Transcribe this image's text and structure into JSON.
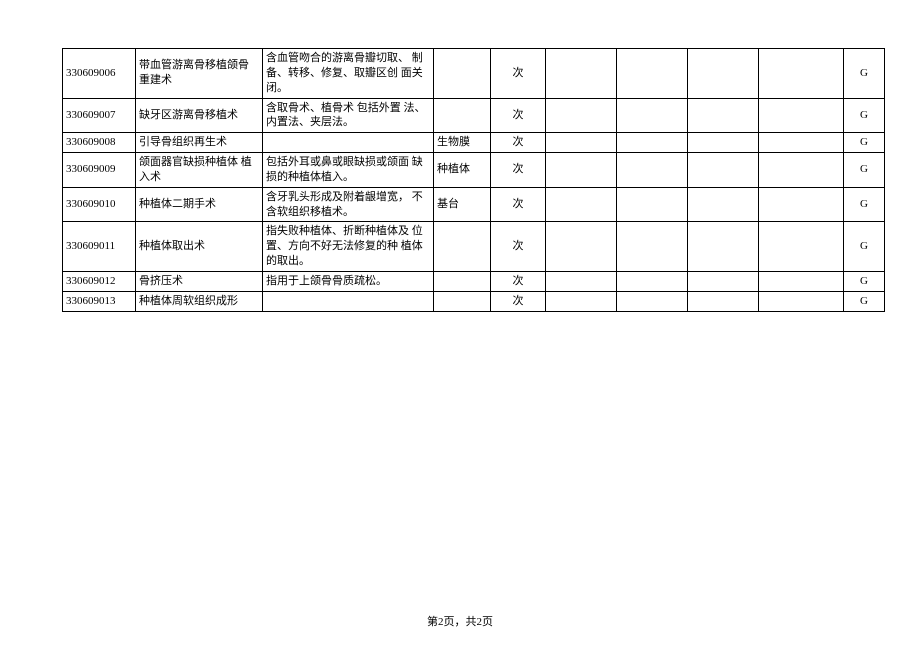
{
  "table": {
    "rows": [
      {
        "code": "330609006",
        "name": "带血管游离骨移植颌骨重建术",
        "desc": "含血管吻合的游离骨瓣切取、 制备、转移、修复、取瓣区创 面关闭。",
        "note": "",
        "unit": "次",
        "a": "",
        "b": "",
        "c": "",
        "d": "",
        "grade": "G"
      },
      {
        "code": "330609007",
        "name": "缺牙区游离骨移植术",
        "desc": "含取骨术、植骨术 包括外置 法、内置法、夹层法。",
        "note": "",
        "unit": "次",
        "a": "",
        "b": "",
        "c": "",
        "d": "",
        "grade": "G"
      },
      {
        "code": "330609008",
        "name": "引导骨组织再生术",
        "desc": "",
        "note": "生物膜",
        "unit": "次",
        "a": "",
        "b": "",
        "c": "",
        "d": "",
        "grade": "G"
      },
      {
        "code": "330609009",
        "name": "颌面器官缺损种植体 植入术",
        "desc": "包括外耳或鼻或眼缺损或颌面 缺损的种植体植入。",
        "note": "种植体",
        "unit": "次",
        "a": "",
        "b": "",
        "c": "",
        "d": "",
        "grade": "G"
      },
      {
        "code": "330609010",
        "name": "种植体二期手术",
        "desc": "含牙乳头形成及附着龈增宽， 不含软组织移植术。",
        "note": "基台",
        "unit": "次",
        "a": "",
        "b": "",
        "c": "",
        "d": "",
        "grade": "G"
      },
      {
        "code": "330609011",
        "name": "种植体取出术",
        "desc": "指失败种植体、折断种植体及 位置、方向不好无法修复的种 植体的取出。",
        "note": "",
        "unit": "次",
        "a": "",
        "b": "",
        "c": "",
        "d": "",
        "grade": "G"
      },
      {
        "code": "330609012",
        "name": "骨挤压术",
        "desc": "指用于上颌骨骨质疏松。",
        "note": "",
        "unit": "次",
        "a": "",
        "b": "",
        "c": "",
        "d": "",
        "grade": "G"
      },
      {
        "code": "330609013",
        "name": "种植体周软组织成形",
        "desc": "",
        "note": "",
        "unit": "次",
        "a": "",
        "b": "",
        "c": "",
        "d": "",
        "grade": "G"
      }
    ]
  },
  "footer": "第2页，共2页"
}
